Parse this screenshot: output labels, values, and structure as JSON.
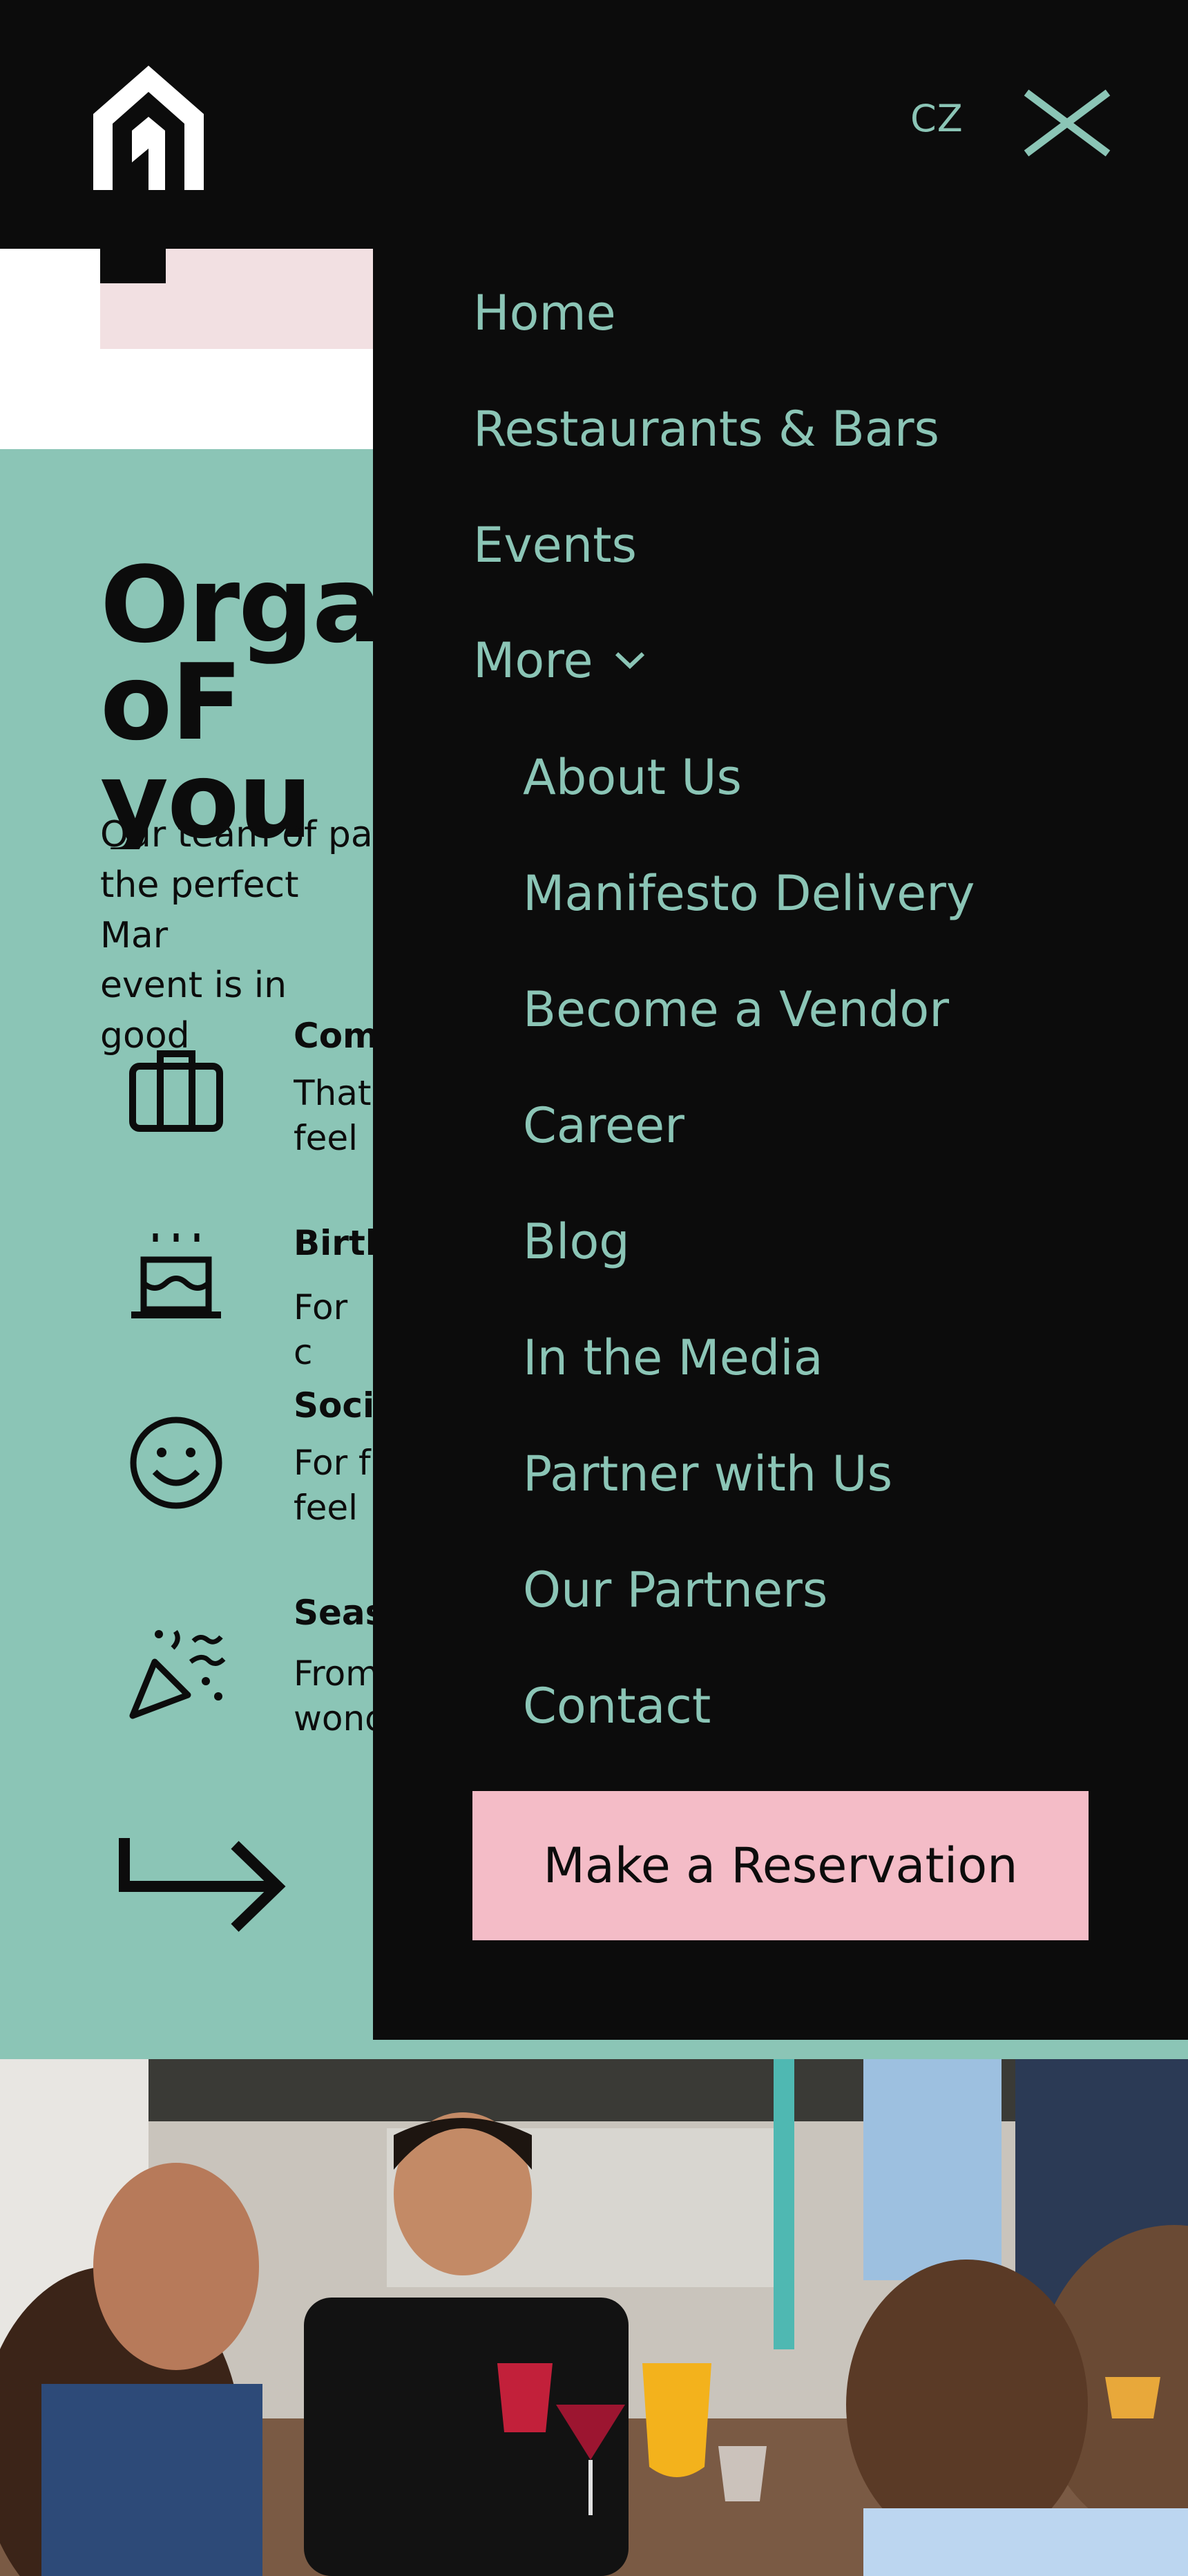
{
  "header": {
    "logo": "home-arch-logo",
    "language_label": "CZ",
    "close_icon": "close-icon"
  },
  "section": {
    "title": "Organ\noF you",
    "description": "Our team of pa\nthe perfect Mar\nevent is in good",
    "features": [
      {
        "icon": "briefcase-icon",
        "title": "Com",
        "text": "That\nfeel"
      },
      {
        "icon": "birthday-cake-icon",
        "title": "Birth",
        "text": "For c"
      },
      {
        "icon": "smiley-icon",
        "title": "Soci",
        "text": "For f\nfeel"
      },
      {
        "icon": "party-popper-icon",
        "title": "Seas",
        "text": "From\nwond"
      }
    ],
    "arrow_icon": "arrow-right-icon"
  },
  "menu": {
    "items": [
      {
        "label": "Home"
      },
      {
        "label": "Restaurants & Bars"
      },
      {
        "label": "Events"
      }
    ],
    "more_label": "More",
    "more_icon": "chevron-down-icon",
    "sub_items": [
      {
        "label": "About Us"
      },
      {
        "label": "Manifesto Delivery"
      },
      {
        "label": "Become a Vendor"
      },
      {
        "label": "Career"
      },
      {
        "label": "Blog"
      },
      {
        "label": "In the Media"
      },
      {
        "label": "Partner with Us"
      },
      {
        "label": "Our Partners"
      },
      {
        "label": "Contact"
      }
    ],
    "cta_label": "Make a Reservation"
  },
  "colors": {
    "background": "#0c0c0c",
    "accent_teal": "#8bc5b6",
    "cta_pink": "#f4bcc7",
    "light_pink": "#f2e0e2"
  }
}
